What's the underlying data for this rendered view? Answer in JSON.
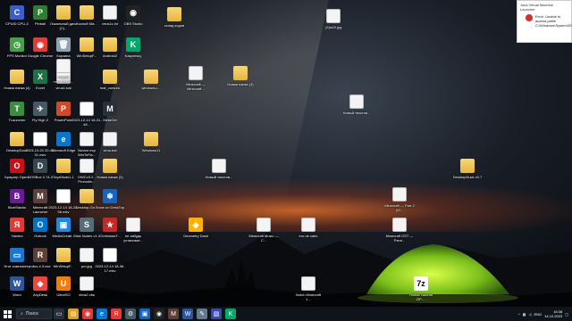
{
  "desktop": {
    "icons": [
      {
        "id": "cpuid",
        "label": "CPUID CPU-Z",
        "type": "app",
        "color": "#3a5fcd",
        "glyph": "C"
      },
      {
        "id": "pinball",
        "label": "Pinball",
        "type": "app",
        "color": "#2e7d32",
        "glyph": "P"
      },
      {
        "id": "local-disk",
        "label": "Локальный диск (C)...",
        "type": "folder"
      },
      {
        "id": "new-folder-top",
        "label": "Косной Ма...",
        "type": "folder"
      },
      {
        "id": "virus-txt",
        "label": "virus1c.txt",
        "type": "doc"
      },
      {
        "id": "obs",
        "label": "OBS Studio",
        "type": "app",
        "color": "#222",
        "glyph": "◉"
      },
      {
        "id": "fps-monitor",
        "label": "FPS Monitor",
        "type": "app",
        "color": "#43a047",
        "glyph": "◷"
      },
      {
        "id": "chrome",
        "label": "Google Chrome",
        "type": "app",
        "color": "#e53935",
        "glyph": "◉"
      },
      {
        "id": "recycle",
        "label": "Корзина",
        "type": "app",
        "color": "#90a4ae",
        "glyph": "🗑"
      },
      {
        "id": "winsetup",
        "label": "WinSetupF...",
        "type": "folder"
      },
      {
        "id": "android",
        "label": "Android2",
        "type": "folder"
      },
      {
        "id": "kaspersky",
        "label": "Kaspersky",
        "type": "app",
        "color": "#00a86b",
        "glyph": "K"
      },
      {
        "id": "new-folder-4",
        "label": "Новая папка (4)",
        "type": "folder"
      },
      {
        "id": "excel",
        "label": "Excel",
        "type": "app",
        "color": "#1e7145",
        "glyph": "X"
      },
      {
        "id": "virus-bat",
        "label": "virus1.bat",
        "type": "doc"
      },
      {
        "id": "leaf-cursors",
        "label": "leaf_cursors",
        "type": "folder"
      },
      {
        "id": "windows-folder",
        "label": "windows-r...",
        "type": "folder"
      },
      {
        "id": "new-text",
        "label": "Новый текстовый...",
        "type": "doc"
      },
      {
        "id": "tlauncher",
        "label": "TLauncher",
        "type": "app",
        "color": "#388e3c",
        "glyph": "T"
      },
      {
        "id": "fly-high",
        "label": "Fly High 2",
        "type": "app",
        "color": "#455a64",
        "glyph": "✈"
      },
      {
        "id": "powerpoint",
        "label": "PowerPoint",
        "type": "app",
        "color": "#d24726",
        "glyph": "P"
      },
      {
        "id": "screenshot-1",
        "label": "2023-12-14 18-31-48...",
        "type": "video"
      },
      {
        "id": "metaget",
        "label": "MetaGet",
        "type": "app",
        "color": "#263238",
        "glyph": "M"
      },
      {
        "id": "desktop-duck",
        "label": "DesktopDuck",
        "type": "folder"
      },
      {
        "id": "screen-2",
        "label": "2023-10-20 20-48-31.mkv",
        "type": "video"
      },
      {
        "id": "edge",
        "label": "Microsoft Edge",
        "type": "app",
        "color": "#0078d4",
        "glyph": "e"
      },
      {
        "id": "novice",
        "label": "Novice.exp WinToFla...",
        "type": "doc"
      },
      {
        "id": "virus-bat2",
        "label": "virus.bat",
        "type": "doc"
      },
      {
        "id": "windows11",
        "label": "Windows11",
        "type": "folder"
      },
      {
        "id": "opera",
        "label": "Браузер Opera",
        "type": "app",
        "color": "#cc0f16",
        "glyph": "O"
      },
      {
        "id": "dosbox",
        "label": "DOSBox 0.74-3",
        "type": "app",
        "color": "#37474f",
        "glyph": "D"
      },
      {
        "id": "toymods",
        "label": "ToyzMods1-1",
        "type": "folder"
      },
      {
        "id": "dwc",
        "label": "DWCv3.2 - Promotin...",
        "type": "doc"
      },
      {
        "id": "new-folder-2",
        "label": "Новая папка (2)",
        "type": "folder"
      },
      {
        "id": "bluestacks",
        "label": "BlueStacks",
        "type": "app",
        "color": "#6a1b9a",
        "glyph": "B"
      },
      {
        "id": "mc-launcher",
        "label": "Minecraft Launcher",
        "type": "app",
        "color": "#5d4037",
        "glyph": "M"
      },
      {
        "id": "screen-3",
        "label": "2023-12-14 18-28-56.mkv",
        "type": "video"
      },
      {
        "id": "desktop-goose",
        "label": "Desktop-Go...",
        "type": "folder"
      },
      {
        "id": "snow",
        "label": "Snow on DeskTop",
        "type": "app",
        "color": "#1565c0",
        "glyph": "❄"
      },
      {
        "id": "yandex",
        "label": "Yandex",
        "type": "app",
        "color": "#e53935",
        "glyph": "Я"
      },
      {
        "id": "outlook",
        "label": "Outlook",
        "type": "app",
        "color": "#0072c6",
        "glyph": "O"
      },
      {
        "id": "mediacreation",
        "label": "MediaCreati...",
        "type": "app",
        "color": "#1e88e5",
        "glyph": "▣"
      },
      {
        "id": "stick-nodes",
        "label": "Stick Nodes v1.1",
        "type": "app",
        "color": "#546e7a",
        "glyph": "S"
      },
      {
        "id": "christmas",
        "label": "ChristmasT...",
        "type": "app",
        "color": "#c62828",
        "glyph": "★"
      },
      {
        "id": "ne-zabud",
        "label": "не забудь установит...",
        "type": "doc"
      },
      {
        "id": "this-pc",
        "label": "Этот компьютер",
        "type": "app",
        "color": "#1976d2",
        "glyph": "▭"
      },
      {
        "id": "rufus",
        "label": "rufus-4.3.exe",
        "type": "app",
        "color": "#5d4037",
        "glyph": "R"
      },
      {
        "id": "winsetupfrom",
        "label": "WinSetupF...",
        "type": "folder"
      },
      {
        "id": "pm-jpg",
        "label": "pm.jpg",
        "type": "doc"
      },
      {
        "id": "screen-4",
        "label": "2023-12-14 18-36-17.mkv",
        "type": "video"
      },
      {
        "id": "word",
        "label": "Word",
        "type": "app",
        "color": "#2b579a",
        "glyph": "W"
      },
      {
        "id": "anydesk",
        "label": "AnyDesk",
        "type": "app",
        "color": "#ef443b",
        "glyph": "◆"
      },
      {
        "id": "ultraiso",
        "label": "UltraISO",
        "type": "app",
        "color": "#f57c00",
        "glyph": "U"
      },
      {
        "id": "virus2",
        "label": "virus2.vbs",
        "type": "doc"
      },
      {
        "id": "folder-codes",
        "label": "склад кодов",
        "type": "folder"
      },
      {
        "id": "image-top",
        "label": "(2)ls49.jpg",
        "type": "doc"
      },
      {
        "id": "mc-1",
        "label": "Minecraft — Minecraft...",
        "type": "doc"
      },
      {
        "id": "new-folder-3",
        "label": "Новая папка (3)",
        "type": "folder"
      },
      {
        "id": "new-text-2",
        "label": "Новый текстов...",
        "type": "doc"
      },
      {
        "id": "new-text-3",
        "label": "Новый текстов...",
        "type": "doc"
      },
      {
        "id": "desktop-duck-2",
        "label": "DesktopDuck v0.7",
        "type": "folder"
      },
      {
        "id": "mc-part2",
        "label": "Minecraft — Part 2 (M...",
        "type": "doc"
      },
      {
        "id": "geometry",
        "label": "Geometry Dash",
        "type": "app",
        "color": "#ffb300",
        "glyph": "◆"
      },
      {
        "id": "mc-music",
        "label": "Minecraft Music — C...",
        "type": "doc"
      },
      {
        "id": "ero-calm",
        "label": "ero ne calm",
        "type": "doc"
      },
      {
        "id": "mc-ost",
        "label": "Minecraft OST — Pann...",
        "type": "doc"
      },
      {
        "id": "notch",
        "label": "Notch Minecraft 1...",
        "type": "doc"
      },
      {
        "id": "new-archive",
        "label": "Новая сжатая ZIP-...",
        "type": "app",
        "color": "#ffffff",
        "glyph": "7z"
      }
    ]
  },
  "popup": {
    "title": "Java Virtual Machine Launcher",
    "message": "Error: Unable to access jarfile C:\\Windows\\System32\\..."
  },
  "taskbar": {
    "search_placeholder": "Поиск",
    "tray_lang": "ENG",
    "time": "18:38",
    "date": "14.12.2023"
  }
}
